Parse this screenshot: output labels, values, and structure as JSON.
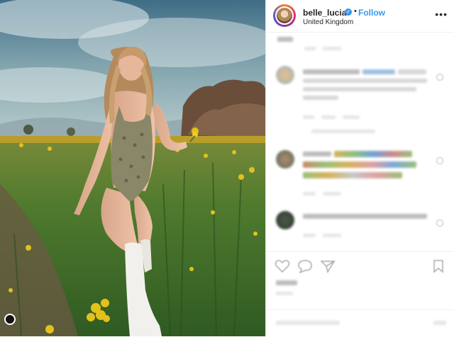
{
  "post": {
    "username": "belle_lucia",
    "verified_mark": "✓",
    "separator": "•",
    "follow_label": "Follow",
    "location": "United Kingdom",
    "more_label": "•••"
  }
}
